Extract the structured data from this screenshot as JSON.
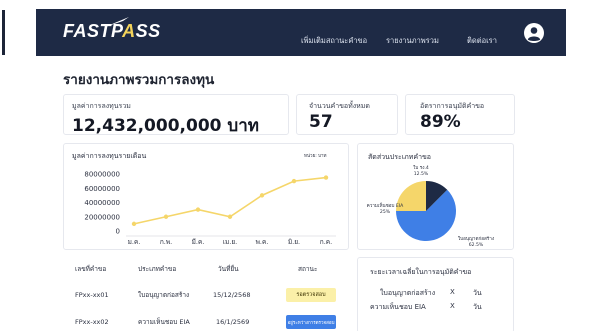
{
  "nav": {
    "logo_text_1": "FASTP",
    "logo_text_2": "SS",
    "links": [
      "เพิ่มเติมสถานะคำขอ",
      "รายงานภาพรวม",
      "ติดต่อเรา"
    ]
  },
  "page_title": "รายงานภาพรวมการลงทุน",
  "stats": {
    "total_investment": {
      "label": "มูลค่าการลงทุนรวม",
      "value": "12,432,000,000 บาท"
    },
    "total_requests": {
      "label": "จำนวนคำขอทั้งหมด",
      "value": "57"
    },
    "approval_rate": {
      "label": "อัตราการอนุมัติคำขอ",
      "value": "89%"
    }
  },
  "line_chart_card": {
    "title": "มูลค่าการลงทุนรายเดือน",
    "unit": "หน่วย: บาท"
  },
  "pie_chart_card": {
    "title": "สัดส่วนประเภทคำขอ"
  },
  "chart_data": [
    {
      "type": "line",
      "title": "มูลค่าการลงทุนรายเดือน",
      "categories": [
        "ม.ค.",
        "ก.พ.",
        "มี.ค.",
        "เม.ย.",
        "พ.ค.",
        "มิ.ย.",
        "ก.ค."
      ],
      "y_ticks": [
        "80000000",
        "60000000",
        "40000000",
        "20000000",
        "0"
      ],
      "ylim": [
        0,
        80000000
      ],
      "series": [
        {
          "values": [
            10000000,
            20000000,
            30000000,
            20000000,
            50000000,
            70000000,
            75000000
          ]
        }
      ],
      "color": "#f5d66a",
      "grid": false
    },
    {
      "type": "pie",
      "title": "สัดส่วนประเภทคำขอ",
      "slices": [
        {
          "label": "ใบอนุญาตก่อสร้าง",
          "pct": "62.5%",
          "value": 62.5,
          "color": "#3f7fe6"
        },
        {
          "label": "ความเห็นชอบ EIA",
          "pct": "25%",
          "value": 25,
          "color": "#f5d66a"
        },
        {
          "label": "ใบ รง.4",
          "pct": "12.5%",
          "value": 12.5,
          "color": "#1e2a45"
        }
      ]
    }
  ],
  "table": {
    "headers": [
      "เลขที่คำขอ",
      "ประเภทคำขอ",
      "วันที่ยื่น",
      "สถานะ"
    ],
    "rows": [
      {
        "id": "FPxx-xx01",
        "type": "ใบอนุญาตก่อสร้าง",
        "date": "15/12/2568",
        "status": "รอตรวจสอบ",
        "status_color": "#fbf0a8"
      },
      {
        "id": "FPxx-xx02",
        "type": "ความเห็นชอบ EIA",
        "date": "16/1/2569",
        "status": "อยู่ระหว่างการตรวจสอบ",
        "status_color": "#3f7fe6"
      }
    ]
  },
  "timing": {
    "title": "ระยะเวลาเฉลี่ยในการอนุมัติคำขอ",
    "rows": [
      {
        "label": "ใบอนุญาตก่อสร้าง",
        "value": "X",
        "unit": "วัน"
      },
      {
        "label": "ความเห็นชอบ EIA",
        "value": "X",
        "unit": "วัน"
      }
    ]
  }
}
